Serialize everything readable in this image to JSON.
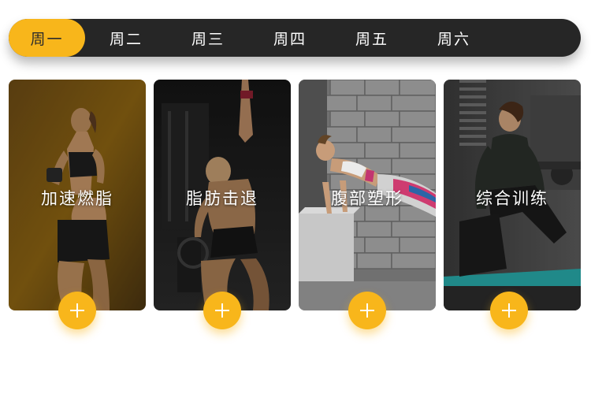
{
  "tabs": [
    {
      "label": "周一",
      "active": true
    },
    {
      "label": "周二",
      "active": false
    },
    {
      "label": "周三",
      "active": false
    },
    {
      "label": "周四",
      "active": false
    },
    {
      "label": "周五",
      "active": false
    },
    {
      "label": "周六",
      "active": false
    }
  ],
  "cards": [
    {
      "title": "加速燃脂"
    },
    {
      "title": "脂肪击退"
    },
    {
      "title": "腹部塑形"
    },
    {
      "title": "综合训练"
    }
  ],
  "colors": {
    "accent": "#f8b61b",
    "tabbar_bg": "#262626"
  },
  "icons": {
    "add": "plus-icon"
  }
}
